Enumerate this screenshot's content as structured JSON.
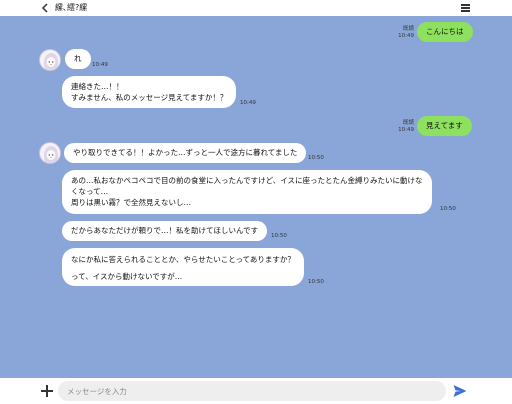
{
  "header": {
    "title": "縲､繧?縲"
  },
  "colors": {
    "background": "#8aa6d8",
    "incoming": "#ffffff",
    "outgoing": "#8ee05f",
    "send": "#3b6fd8"
  },
  "messages": [
    {
      "side": "out",
      "lines": [
        "こんにちは"
      ],
      "read": "既読",
      "time": "10:49"
    },
    {
      "side": "in",
      "avatar": true,
      "lines": [
        "れ"
      ],
      "time": "10:49"
    },
    {
      "side": "in",
      "lines": [
        "連絡きた…！！",
        "すみません、私のメッセージ見えてますか！？"
      ],
      "time": "10:49"
    },
    {
      "side": "out",
      "lines": [
        "見えてます"
      ],
      "read": "既読",
      "time": "10:49"
    },
    {
      "side": "in",
      "avatar": true,
      "lines": [
        "やり取りできてる！！よかった…ずっと一人で途方に暮れてました"
      ],
      "time": "10:50"
    },
    {
      "side": "in",
      "lines": [
        "あの…私おなかペコペコで目の前の食堂に入ったんですけど、イスに座ったとたん金縛りみたいに動けな",
        "くなって…",
        "周りは黒い霧？で全然見えないし…"
      ],
      "time": "10:50"
    },
    {
      "side": "in",
      "lines": [
        "だからあなただけが頼りで…！私を助けてほしいんです"
      ],
      "time": "10:50"
    },
    {
      "side": "in",
      "lines": [
        "なにか私に答えられることとか、やらせたいことってありますか？",
        "",
        "って、イスから動けないですが…"
      ],
      "time": "10:50"
    }
  ],
  "input": {
    "placeholder": "メッセージを入力"
  },
  "icons": {
    "back": "chevron-left-icon",
    "menu": "hamburger-menu-icon",
    "add": "plus-icon",
    "send": "send-icon",
    "avatar": "avatar-icon"
  }
}
